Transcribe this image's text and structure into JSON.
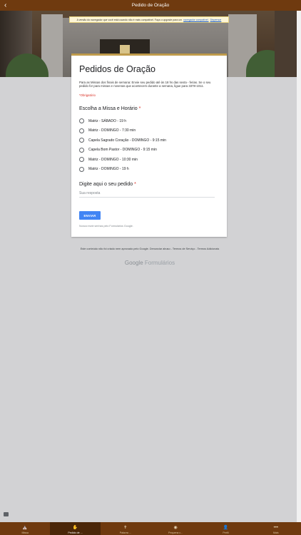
{
  "nav": {
    "title": "Pedido de Oração",
    "back_glyph": "‹"
  },
  "warning": {
    "text": "A versão do navegador que você está usando não é mais compatível. Faça o upgrade para um",
    "link": "navegador compatível.",
    "dismiss": "Dispensar"
  },
  "form": {
    "title": "Pedidos de Oração",
    "description": "Para as Missas dos finais de semana: Envie seu pedido até às 18 hs das sexta - ferias. Se o seu pedido for para missas e novenas que acontecem durante a semana, ligue para 3378-1011.",
    "required_note": "*Obrigatório",
    "question1": {
      "label": "Escolha a Missa e Horário",
      "star": "*"
    },
    "options": [
      "Matriz - SÁBADO - 19 h",
      "Matriz - DOMINGO - 7:30 min",
      "Capela Sagrado Coração - DOMINGO - 9:15 min",
      "Capela Bom Pastor - DOMINGO - 9:15 min",
      "Matriz - DOMINGO - 10:30 min",
      "Matriz - DOMINGO - 19 h"
    ],
    "question2": {
      "label": "Digite aqui o seu pedido",
      "star": "*"
    },
    "answer_placeholder": "Sua resposta",
    "submit_label": "ENVIAR",
    "never_submit": "Nunca envie senhas pelo Formulários Google."
  },
  "footer": {
    "disclaimer": "Este conteúdo não foi criado nem aprovado pelo Google. Denunciar abuso - Termos de Serviço - Termos Adicionais",
    "brand_google": "Google",
    "brand_forms": "Formulários"
  },
  "tabs": [
    {
      "label": "Missa",
      "icon": "church-icon",
      "glyph": "⛪"
    },
    {
      "label": "Pedido de ...",
      "icon": "prayer-icon",
      "glyph": "✋"
    },
    {
      "label": "Palavra ...",
      "icon": "bible-icon",
      "glyph": "✝"
    },
    {
      "label": "Pequena c...",
      "icon": "community-icon",
      "glyph": "◉"
    },
    {
      "label": "Perfil",
      "icon": "profile-icon",
      "glyph": "👤"
    },
    {
      "label": "Mais",
      "icon": "more-icon",
      "glyph": "•••"
    }
  ],
  "active_tab": 1,
  "colors": {
    "brand": "#6f3a0f",
    "accent": "#bf9b4c",
    "button": "#4285f4",
    "required": "#d93025"
  }
}
